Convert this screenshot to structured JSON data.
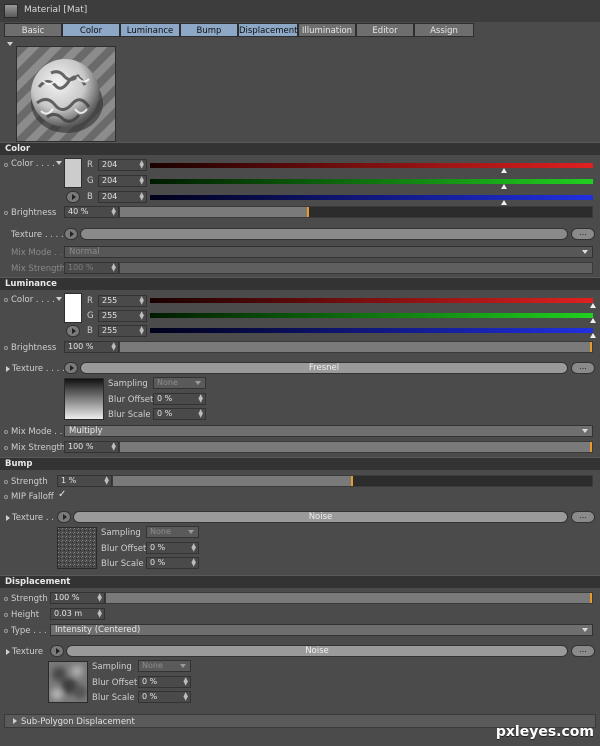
{
  "window": {
    "title": "Material [Mat]"
  },
  "tabs": [
    {
      "label": "Basic",
      "active": false
    },
    {
      "label": "Color",
      "active": true
    },
    {
      "label": "Luminance",
      "active": true
    },
    {
      "label": "Bump",
      "active": true
    },
    {
      "label": "Displacement",
      "active": true
    },
    {
      "label": "Illumination",
      "active": false
    },
    {
      "label": "Editor",
      "active": false
    },
    {
      "label": "Assign",
      "active": false
    }
  ],
  "color": {
    "header": "Color",
    "color_label": "Color . . . .",
    "r_label": "R",
    "g_label": "G",
    "b_label": "B",
    "r": "204",
    "g": "204",
    "b": "204",
    "r_value": 204,
    "g_value": 204,
    "b_value": 204,
    "swatch": "#cccccc",
    "brightness_label": "Brightness",
    "brightness": "40 %",
    "brightness_value": 40,
    "texture_label": "Texture . . . .",
    "texture_more": "...",
    "mixmode_label": "Mix Mode . .",
    "mixmode": "Normal",
    "mixstrength_label": "Mix Strength",
    "mixstrength": "100 %"
  },
  "luminance": {
    "header": "Luminance",
    "color_label": "Color . . . .",
    "r_label": "R",
    "g_label": "G",
    "b_label": "B",
    "r": "255",
    "g": "255",
    "b": "255",
    "r_value": 255,
    "g_value": 255,
    "b_value": 255,
    "swatch": "#ffffff",
    "brightness_label": "Brightness",
    "brightness": "100 %",
    "brightness_value": 100,
    "texture_label": "Texture . . . .",
    "texture_name": "Fresnel",
    "texture_more": "...",
    "sampling_label": "Sampling",
    "sampling": "None",
    "bluroffset_label": "Blur Offset",
    "bluroffset": "0 %",
    "blurscale_label": "Blur Scale",
    "blurscale": "0 %",
    "mixmode_label": "Mix Mode . .",
    "mixmode": "Multiply",
    "mixstrength_label": "Mix Strength",
    "mixstrength": "100 %",
    "mixstrength_value": 100
  },
  "bump": {
    "header": "Bump",
    "strength_label": "Strength",
    "strength": "1 %",
    "strength_value": 1,
    "mipfalloff_label": "MIP Falloff",
    "mipfalloff_check": "✓",
    "texture_label": "Texture . . .",
    "texture_name": "Noise",
    "texture_more": "...",
    "sampling_label": "Sampling",
    "sampling": "None",
    "bluroffset_label": "Blur Offset",
    "bluroffset": "0 %",
    "blurscale_label": "Blur Scale",
    "blurscale": "0 %"
  },
  "displacement": {
    "header": "Displacement",
    "strength_label": "Strength",
    "strength": "100 %",
    "strength_value": 100,
    "height_label": "Height",
    "height": "0.03 m",
    "type_label": "Type . . . .",
    "type": "Intensity (Centered)",
    "texture_label": "Texture",
    "texture_name": "Noise",
    "texture_more": "...",
    "sampling_label": "Sampling",
    "sampling": "None",
    "bluroffset_label": "Blur Offset",
    "bluroffset": "0 %",
    "blurscale_label": "Blur Scale",
    "blurscale": "0 %"
  },
  "footer": {
    "label": "Sub-Polygon Displacement"
  },
  "watermark": "pxleyes.com",
  "icons": [
    "material-app-icon",
    "preview-collapse-icon",
    "circle-arrow-icon",
    "expand-triangle-icon",
    "dropdown-arrow-icon",
    "spinner-icon",
    "checkmark-icon"
  ]
}
